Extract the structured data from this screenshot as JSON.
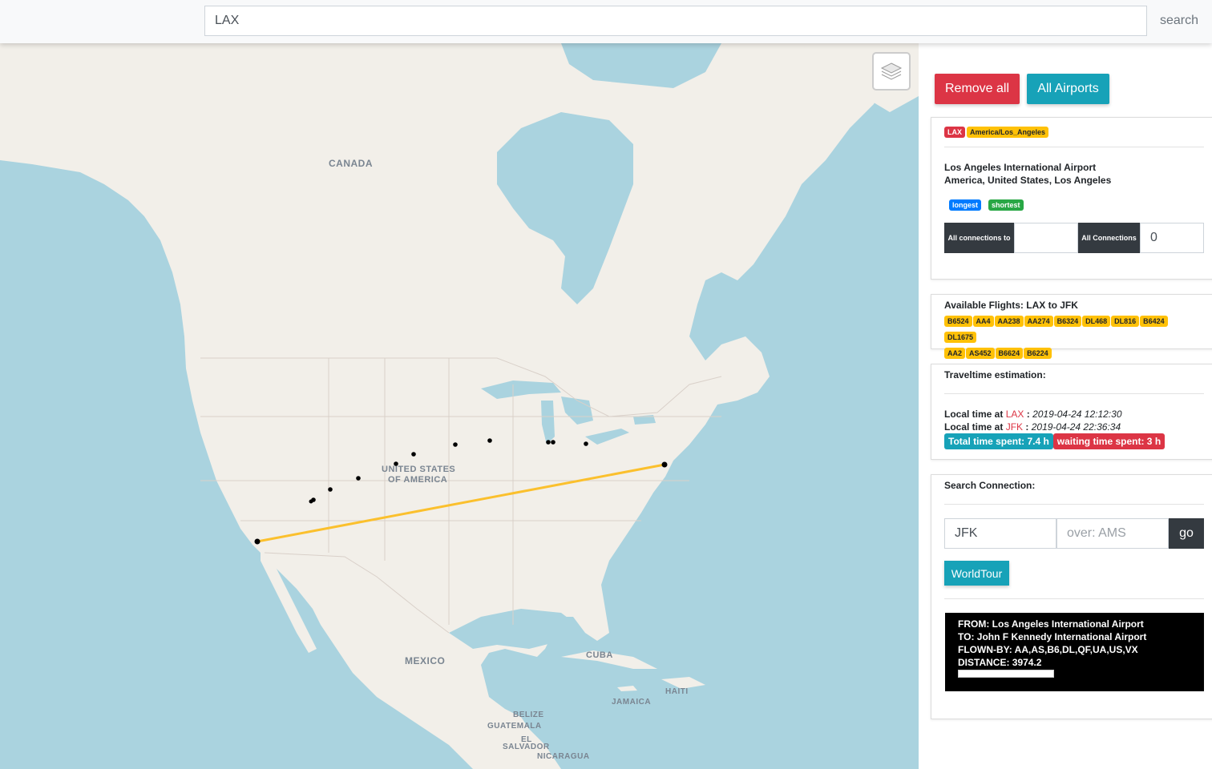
{
  "search": {
    "value": "LAX",
    "button_label": "search"
  },
  "map": {
    "country_labels": [
      "CANADA",
      "UNITED STATES",
      "OF AMERICA",
      "MEXICO",
      "CUBA",
      "HAITI",
      "JAMAICA",
      "BELIZE",
      "GUATEMALA",
      "EL",
      "SALVADOR",
      "NICARAGUA"
    ],
    "route_color": "#fbc02d"
  },
  "actions": {
    "remove_all": "Remove all",
    "all_airports": "All Airports"
  },
  "airport": {
    "code": "LAX",
    "timezone": "America/Los_Angeles",
    "name": "Los Angeles International Airport",
    "location": "America, United States, Los Angeles",
    "filter_longest": "longest",
    "filter_shortest": "shortest",
    "all_connections_to_label": "All connections to",
    "all_connections_label": "All Connections",
    "all_connections_count": "0"
  },
  "flights": {
    "title": "Available Flights: LAX to JFK",
    "codes": [
      "B6524",
      "AA4",
      "AA238",
      "AA274",
      "B6324",
      "DL468",
      "DL816",
      "B6424",
      "DL1675",
      "AA2",
      "AS452",
      "B6624",
      "B6224"
    ]
  },
  "travel": {
    "title": "Traveltime estimation:",
    "local_prefix": "Local time at",
    "from_code": "LAX",
    "from_time": "2019-04-24 12:12:30",
    "to_code": "JFK",
    "to_time": "2019-04-24 22:36:34",
    "total_time": "Total time spent: 7.4 h",
    "waiting_time": "waiting time spent: 3 h"
  },
  "connection": {
    "title": "Search Connection:",
    "to_value": "JFK",
    "via_placeholder": "over: AMS",
    "go_label": "go",
    "worldtour_label": "WorldTour"
  },
  "summary": {
    "from": "FROM: Los Angeles International Airport",
    "to": "TO: John F Kennedy International Airport",
    "flown_by": "FLOWN-BY: AA,AS,B6,DL,QF,UA,US,VX",
    "distance": "DISTANCE: 3974.2"
  },
  "colors": {
    "danger": "#dc3545",
    "info": "#17a2b8",
    "warning": "#ffc107",
    "primary": "#007bff",
    "success": "#28a745",
    "dark": "#343a40"
  }
}
